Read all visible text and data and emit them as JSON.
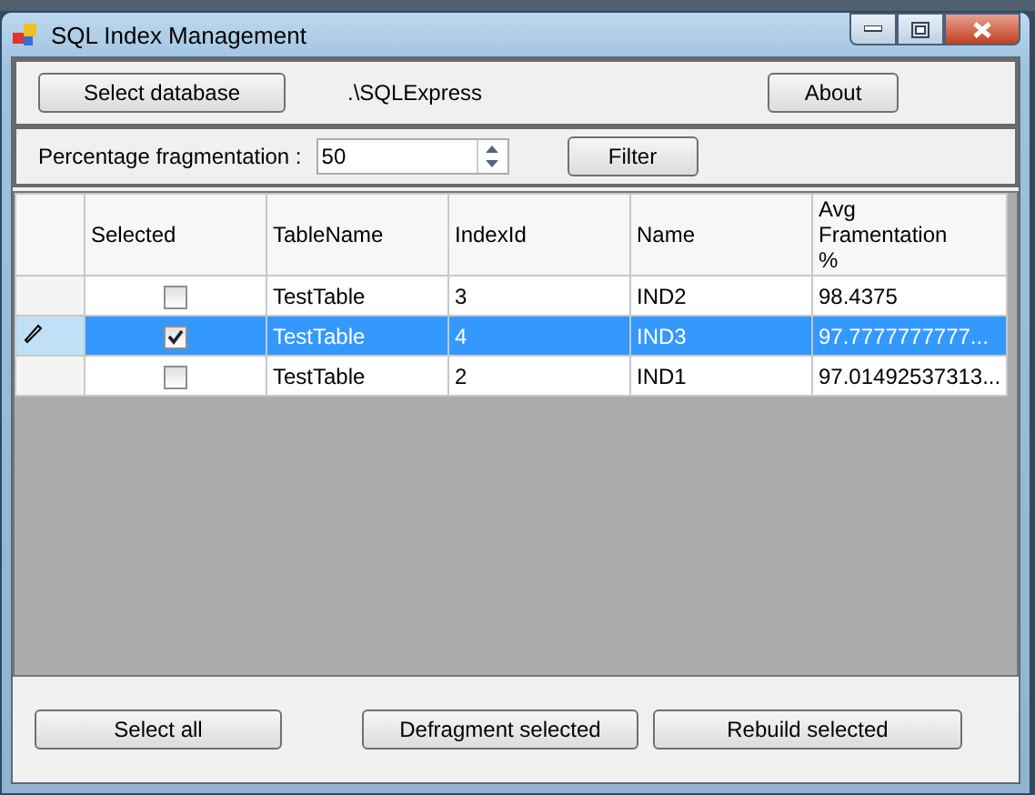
{
  "window": {
    "title": "SQL Index Management"
  },
  "database": {
    "button": "Select database",
    "server": ".\\SQLExpress",
    "about": "About"
  },
  "filter": {
    "label": "Percentage fragmentation :",
    "value": "50",
    "button": "Filter"
  },
  "table": {
    "checkbox_column": "Selected",
    "columns": [
      "TableName",
      "IndexId",
      "Name",
      "Avg\nFramentation\n%"
    ],
    "rows": [
      {
        "checked": false,
        "selected": false,
        "editing": false,
        "cells": [
          "TestTable",
          "3",
          "IND2",
          "98.4375"
        ]
      },
      {
        "checked": true,
        "selected": true,
        "editing": true,
        "cells": [
          "TestTable",
          "4",
          "IND3",
          "97.7777777777..."
        ]
      },
      {
        "checked": false,
        "selected": false,
        "editing": false,
        "cells": [
          "TestTable",
          "2",
          "IND1",
          "97.01492537313..."
        ]
      }
    ]
  },
  "buttons": [
    "Select all",
    "Defragment selected",
    "Rebuild selected"
  ]
}
